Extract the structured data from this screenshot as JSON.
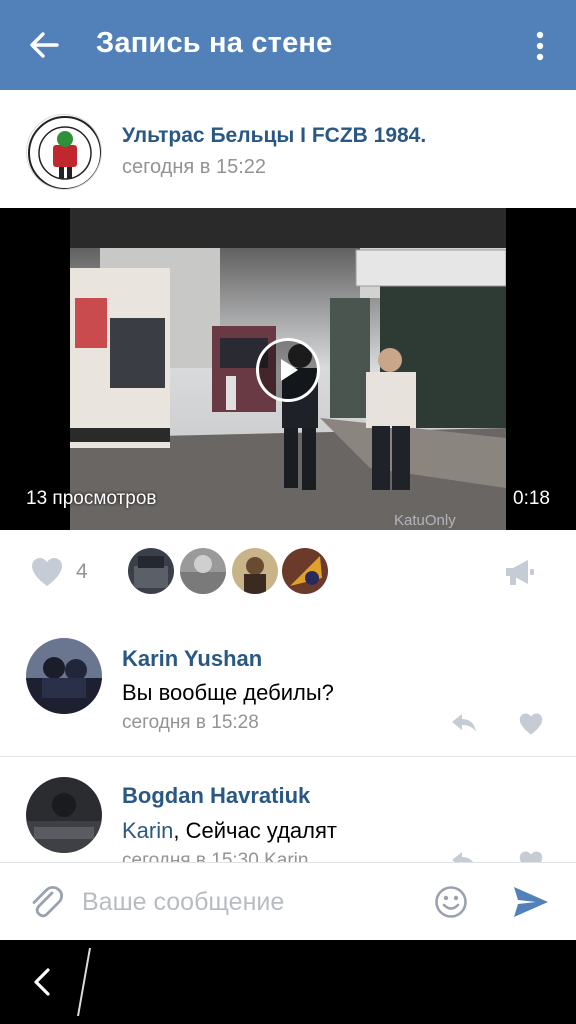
{
  "header": {
    "title": "Запись на стене"
  },
  "post": {
    "group_name": "Ультрас Бельцы I FCZB 1984.",
    "time": "сегодня в 15:22",
    "avatar_text_top": "ULTRAS",
    "avatar_text_bottom": "BELTSY"
  },
  "video": {
    "views": "13 просмотров",
    "duration": "0:18",
    "watermark": "KatuOnly"
  },
  "likes": {
    "count": "4",
    "liker_colors": [
      "#3a3f4a",
      "#9a9a9a",
      "#c9b48a",
      "#6b3a2a"
    ]
  },
  "comments": [
    {
      "author": "Karin Yushan",
      "text": "Вы вообще дебилы?",
      "time": "сегодня в 15:28"
    },
    {
      "author": "Bogdan Havratiuk",
      "mention": "Karin",
      "text": ", Сейчас удалят",
      "time": "сегодня в 15:30 Karin"
    }
  ],
  "composer": {
    "placeholder": "Ваше сообщение"
  },
  "colors": {
    "accent": "#5181b8",
    "link": "#2a5885",
    "secondary_text": "#939393",
    "icon_gray": "#c5ccd5"
  }
}
